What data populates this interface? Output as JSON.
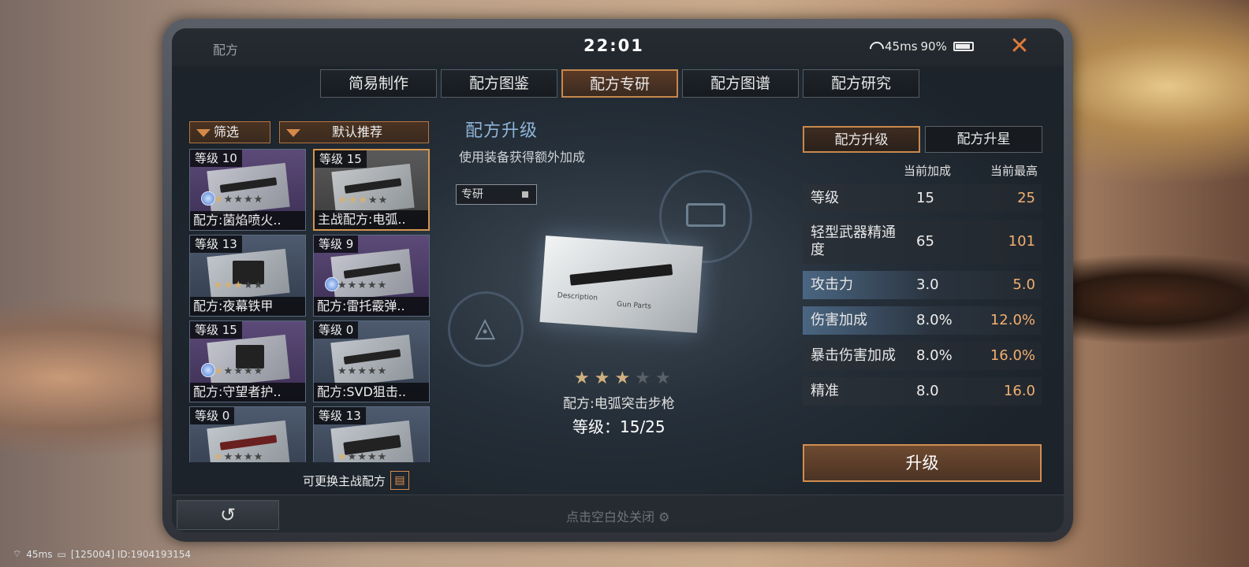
{
  "window": {
    "title": "配方",
    "clock": "22:01",
    "ping": "45ms",
    "battery": "90%"
  },
  "tabs": [
    {
      "label": "简易制作"
    },
    {
      "label": "配方图鉴"
    },
    {
      "label": "配方专研"
    },
    {
      "label": "配方图谱"
    },
    {
      "label": "配方研究"
    }
  ],
  "active_tab": "配方专研",
  "left": {
    "filter_label": "筛选",
    "sort_label": "默认推荐",
    "swap_hint": "可更换主战配方",
    "cards": [
      {
        "level": "等级 10",
        "name": "配方:菌焰喷火..",
        "stars": 1
      },
      {
        "level": "等级 15",
        "name": "主战配方:电弧..",
        "stars": 3
      },
      {
        "level": "等级 13",
        "name": "配方:夜幕铁甲",
        "stars": 3
      },
      {
        "level": "等级 9",
        "name": "配方:雷托霰弹..",
        "stars": 0
      },
      {
        "level": "等级 15",
        "name": "配方:守望者护..",
        "stars": 1
      },
      {
        "level": "等级 0",
        "name": "配方:SVD狙击..",
        "stars": 0
      },
      {
        "level": "等级 0",
        "name": "",
        "stars": 1
      },
      {
        "level": "等级 13",
        "name": "",
        "stars": 1
      }
    ]
  },
  "center": {
    "title": "配方升级",
    "subtitle": "使用装备获得额外加成",
    "spec_label": "专研",
    "blueprint_text_1": "Description",
    "blueprint_text_2": "Gun Parts",
    "stars_filled": 3,
    "stars_total": 5,
    "recipe_name": "配方:电弧突击步枪",
    "level_line": "等级：15/25"
  },
  "right": {
    "tab_upgrade": "配方升级",
    "tab_star": "配方升星",
    "col_current": "当前加成",
    "col_max": "当前最高",
    "rows": [
      {
        "label": "等级",
        "current": "15",
        "max": "25"
      },
      {
        "label": "轻型武器精通度",
        "current": "65",
        "max": "101"
      },
      {
        "label": "攻击力",
        "current": "3.0",
        "max": "5.0"
      },
      {
        "label": "伤害加成",
        "current": "8.0%",
        "max": "12.0%"
      },
      {
        "label": "暴击伤害加成",
        "current": "8.0%",
        "max": "16.0%"
      },
      {
        "label": "精准",
        "current": "8.0",
        "max": "16.0"
      }
    ],
    "upgrade_button": "升级"
  },
  "bottom": {
    "back_icon": "↺",
    "close_hint": "点击空白处关闭"
  },
  "footer": {
    "ping": "45ms",
    "id_text": "[125004] ID:1904193154"
  },
  "colors": {
    "accent": "#c7874a",
    "title_blue": "#8fb4d8",
    "max_orange": "#f1b070"
  }
}
